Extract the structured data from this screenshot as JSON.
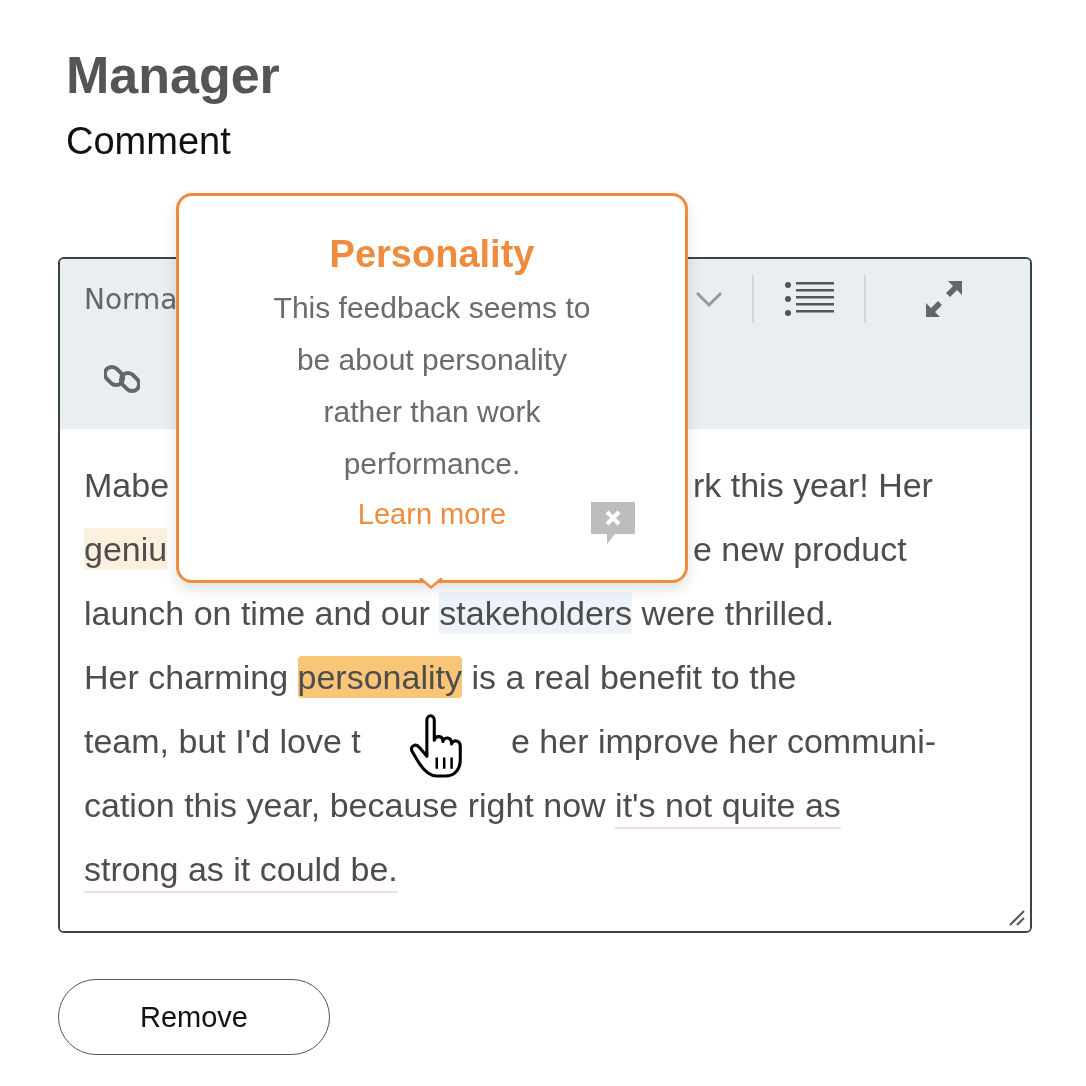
{
  "heading": "Manager",
  "field_label": "Comment",
  "editor": {
    "format_select": "Norma",
    "lines": [
      {
        "segments": [
          {
            "kind": "plain",
            "text": "Mabe"
          },
          {
            "kind": "plain",
            "text": "rk this year! Her"
          }
        ]
      },
      {
        "segments": [
          {
            "kind": "faint",
            "text": "geniu"
          },
          {
            "kind": "plain",
            "text": "e new product"
          }
        ]
      },
      {
        "segments": [
          {
            "kind": "plain",
            "text": "launch on time and our "
          },
          {
            "kind": "info",
            "text": "stakeholders"
          },
          {
            "kind": "plain",
            "text": " were thrilled."
          }
        ]
      },
      {
        "segments": [
          {
            "kind": "plain",
            "text": "Her charming "
          },
          {
            "kind": "strong",
            "text": "personality"
          },
          {
            "kind": "plain",
            "text": " is a real benefit to the"
          }
        ]
      },
      {
        "segments": [
          {
            "kind": "plain",
            "text": "team, but I'd love t"
          },
          {
            "kind": "plain",
            "text": "e her improve her communi-"
          }
        ]
      },
      {
        "segments": [
          {
            "kind": "plain",
            "text": "cation this year, because right now "
          },
          {
            "kind": "underline",
            "text": "it's not quite as"
          }
        ]
      },
      {
        "segments": [
          {
            "kind": "underline",
            "text": "strong as it could be."
          }
        ]
      }
    ]
  },
  "popover": {
    "title": "Personality",
    "message": "This feedback seems to be about personality rather than work performance.",
    "link": "Learn more"
  },
  "buttons": [
    "Remove"
  ]
}
